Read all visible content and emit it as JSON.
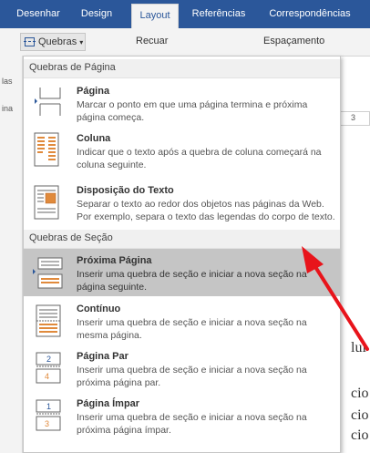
{
  "ribbon": {
    "tabs": [
      {
        "label": "Desenhar",
        "active": false
      },
      {
        "label": "Design",
        "active": false
      },
      {
        "label": "Layout",
        "active": true
      },
      {
        "label": "Referências",
        "active": false
      },
      {
        "label": "Correspondências",
        "active": false
      }
    ],
    "toolbar": {
      "quebras_label": "Quebras",
      "recuar_label": "Recuar",
      "espacamento_label": "Espaçamento"
    }
  },
  "left_fragments": [
    "las",
    "ina"
  ],
  "document": {
    "ruler_text": "3",
    "fragments": [
      "lui",
      "cio",
      "cio",
      "cio"
    ]
  },
  "menu": {
    "sections": [
      {
        "header": "Quebras de Página",
        "items": [
          {
            "title": "Página",
            "description": "Marcar o ponto em que uma página termina e próxima página começa.",
            "icon": "page-break-icon",
            "highlighted": false
          },
          {
            "title": "Coluna",
            "description": "Indicar que o texto após a quebra de coluna começará na coluna seguinte.",
            "icon": "column-break-icon",
            "highlighted": false
          },
          {
            "title": "Disposição do Texto",
            "description": "Separar o texto ao redor dos objetos nas páginas da Web. Por exemplo, separa o texto das legendas do corpo de texto.",
            "icon": "text-wrapping-icon",
            "highlighted": false
          }
        ]
      },
      {
        "header": "Quebras de Seção",
        "items": [
          {
            "title": "Próxima Página",
            "description": "Inserir uma quebra de seção e iniciar a nova seção na página seguinte.",
            "icon": "next-page-section-icon",
            "highlighted": true
          },
          {
            "title": "Contínuo",
            "description": "Inserir uma quebra de seção e iniciar a nova seção na mesma página.",
            "icon": "continuous-section-icon",
            "highlighted": false
          },
          {
            "title": "Página Par",
            "description": "Inserir uma quebra de seção e iniciar a nova seção na próxima página par.",
            "icon": "even-page-section-icon",
            "highlighted": false
          },
          {
            "title": "Página Ímpar",
            "description": "Inserir uma quebra de seção e iniciar a nova seção na próxima página ímpar.",
            "icon": "odd-page-section-icon",
            "highlighted": false
          }
        ]
      }
    ]
  },
  "colors": {
    "ribbon_blue": "#2b579a",
    "highlight": "#c5c5c5",
    "annotation_arrow": "#e8141b"
  },
  "annotation": {
    "icon": "red-arrow-icon"
  }
}
